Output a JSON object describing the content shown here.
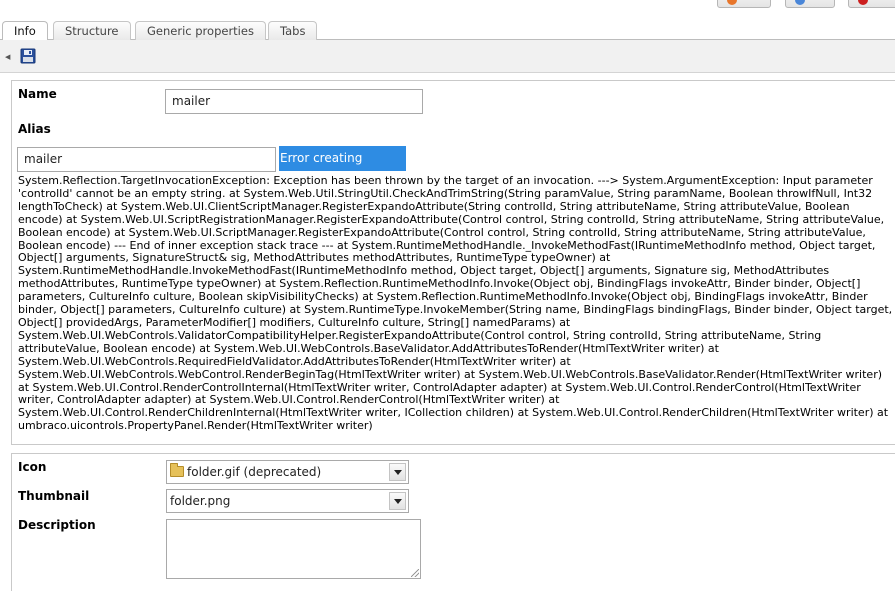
{
  "tabs": [
    {
      "label": "Info"
    },
    {
      "label": "Structure"
    },
    {
      "label": "Generic properties"
    },
    {
      "label": "Tabs"
    }
  ],
  "toolbar": {
    "save_icon": "floppy-disk-icon"
  },
  "form": {
    "name_label": "Name",
    "name_value": "mailer",
    "alias_label": "Alias",
    "alias_value": "mailer",
    "error_button_label": "Error creating control",
    "error_message": "System.Reflection.TargetInvocationException: Exception has been thrown by the target of an invocation. ---> System.ArgumentException: Input parameter 'controlId' cannot be an empty string. at System.Web.Util.StringUtil.CheckAndTrimString(String paramValue, String paramName, Boolean throwIfNull, Int32 lengthToCheck) at System.Web.UI.ClientScriptManager.RegisterExpandoAttribute(String controlId, String attributeName, String attributeValue, Boolean encode) at System.Web.UI.ScriptRegistrationManager.RegisterExpandoAttribute(Control control, String controlId, String attributeName, String attributeValue, Boolean encode) at System.Web.UI.ScriptManager.RegisterExpandoAttribute(Control control, String controlId, String attributeName, String attributeValue, Boolean encode) --- End of inner exception stack trace --- at System.RuntimeMethodHandle._InvokeMethodFast(IRuntimeMethodInfo method, Object target, Object[] arguments, SignatureStruct& sig, MethodAttributes methodAttributes, RuntimeType typeOwner) at System.RuntimeMethodHandle.InvokeMethodFast(IRuntimeMethodInfo method, Object target, Object[] arguments, Signature sig, MethodAttributes methodAttributes, RuntimeType typeOwner) at System.Reflection.RuntimeMethodInfo.Invoke(Object obj, BindingFlags invokeAttr, Binder binder, Object[] parameters, CultureInfo culture, Boolean skipVisibilityChecks) at System.Reflection.RuntimeMethodInfo.Invoke(Object obj, BindingFlags invokeAttr, Binder binder, Object[] parameters, CultureInfo culture) at System.RuntimeType.InvokeMember(String name, BindingFlags bindingFlags, Binder binder, Object target, Object[] providedArgs, ParameterModifier[] modifiers, CultureInfo culture, String[] namedParams) at System.Web.UI.WebControls.ValidatorCompatibilityHelper.RegisterExpandoAttribute(Control control, String controlId, String attributeName, String attributeValue, Boolean encode) at System.Web.UI.WebControls.BaseValidator.AddAttributesToRender(HtmlTextWriter writer) at System.Web.UI.WebControls.RequiredFieldValidator.AddAttributesToRender(HtmlTextWriter writer) at System.Web.UI.WebControls.WebControl.RenderBeginTag(HtmlTextWriter writer) at System.Web.UI.WebControls.BaseValidator.Render(HtmlTextWriter writer) at System.Web.UI.Control.RenderControlInternal(HtmlTextWriter writer, ControlAdapter adapter) at System.Web.UI.Control.RenderControl(HtmlTextWriter writer, ControlAdapter adapter) at System.Web.UI.Control.RenderControl(HtmlTextWriter writer) at System.Web.UI.Control.RenderChildrenInternal(HtmlTextWriter writer, ICollection children) at System.Web.UI.Control.RenderChildren(HtmlTextWriter writer) at umbraco.uicontrols.PropertyPanel.Render(HtmlTextWriter writer)",
    "icon_label": "Icon",
    "icon_value": "folder.gif (deprecated)",
    "thumbnail_label": "Thumbnail",
    "thumbnail_value": "folder.png",
    "description_label": "Description",
    "description_value": ""
  },
  "colors": {
    "error_button": "#2e8ce3",
    "toolbar_bg": "#f1f1f1"
  }
}
